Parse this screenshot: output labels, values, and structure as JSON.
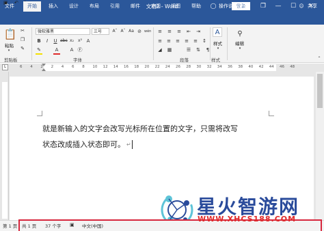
{
  "titlebar": {
    "doc_title": "文档2 - Word",
    "login_label": "登录",
    "quick_access": [
      "save-icon",
      "undo-icon",
      "redo-icon",
      "customize-icon"
    ],
    "controls": {
      "restore": "❐",
      "minimize": "—",
      "maximize": "☐",
      "close": "✕"
    }
  },
  "tabs": [
    {
      "label": "文件"
    },
    {
      "label": "开始",
      "active": true
    },
    {
      "label": "插入"
    },
    {
      "label": "设计"
    },
    {
      "label": "布局"
    },
    {
      "label": "引用"
    },
    {
      "label": "邮件"
    },
    {
      "label": "审阅"
    },
    {
      "label": "视图"
    },
    {
      "label": "帮助"
    },
    {
      "label": "操作说明搜索"
    }
  ],
  "share_label": "共享",
  "ribbon": {
    "clipboard": {
      "paste_label": "粘贴",
      "group_label": "剪贴板"
    },
    "font": {
      "font_name": "微软雅黑",
      "font_size": "三号",
      "wen": "wén",
      "group_label": "字体"
    },
    "paragraph": {
      "group_label": "段落"
    },
    "styles": {
      "label": "样式",
      "group_label": "样式"
    },
    "editing": {
      "label": "编辑"
    }
  },
  "ruler_numbers": [
    "6",
    "4",
    "2",
    "2",
    "4",
    "6",
    "8",
    "10",
    "12",
    "14",
    "16",
    "18",
    "20",
    "22",
    "24",
    "26",
    "28",
    "30",
    "32",
    "34",
    "36",
    "38",
    "40",
    "42",
    "44",
    "46",
    "48"
  ],
  "document": {
    "line1": "就是新输入的文字会改写光标所在位置的文字，只需将改写",
    "line2": "状态改成插入状态即可。"
  },
  "statusbar": {
    "page": "第 1 页",
    "total_pages": "共 1 页",
    "word_count": "37 个字",
    "language": "中文(中国)"
  },
  "watermark": {
    "title": "星火智游网",
    "url": "WWW.XHCS188.COM"
  },
  "colors": {
    "brand": "#2b579a",
    "highlight_box": "#d7263d",
    "watermark_blue": "#2a4b9b",
    "watermark_red": "#e02b2b"
  }
}
